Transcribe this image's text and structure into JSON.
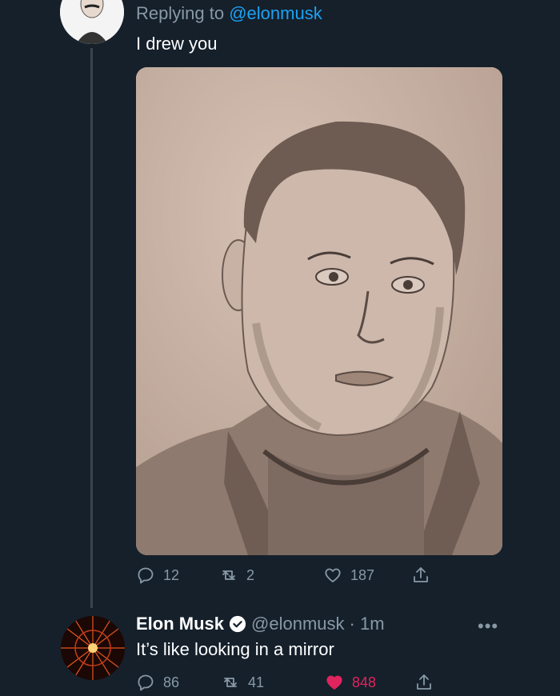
{
  "tweet1": {
    "replying_prefix": "Replying to",
    "replying_handle": "@elonmusk",
    "text": "I drew you",
    "replies": "12",
    "retweets": "2",
    "likes": "187"
  },
  "tweet2": {
    "name": "Elon Musk",
    "handle": "@elonmusk",
    "time": "· 1m",
    "text": "It’s like looking in a mirror",
    "replies": "86",
    "retweets": "41",
    "likes": "848",
    "liked": true
  },
  "colors": {
    "background": "#15202b",
    "muted": "#8899a6",
    "link": "#1da1f2",
    "like": "#e0245e",
    "thread": "#38444d"
  },
  "icons": [
    "reply-icon",
    "retweet-icon",
    "like-icon",
    "share-icon",
    "verified-badge-icon",
    "more-icon"
  ]
}
